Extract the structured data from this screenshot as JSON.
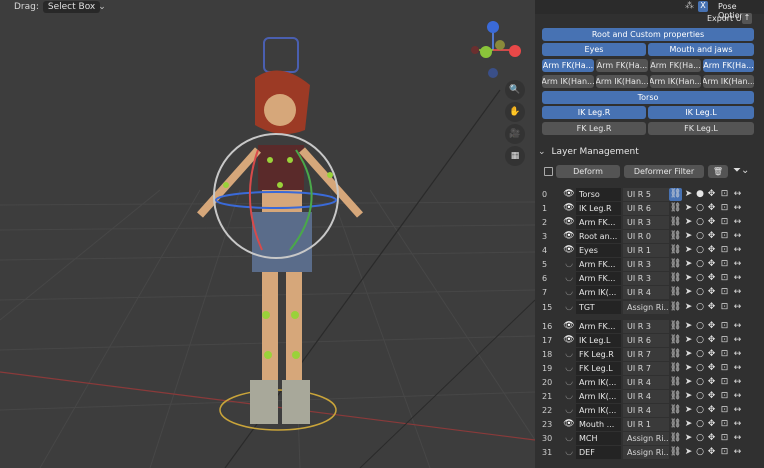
{
  "header": {
    "drag_label": "Drag:",
    "drag_value": "Select Box",
    "pose_options": "Pose Options",
    "export_ui": "Export UI"
  },
  "buttons": {
    "root": "Root and Custom properties",
    "eyes": "Eyes",
    "mouth": "Mouth and jaws",
    "arm_fk_1": "Arm FK(Ha...",
    "arm_fk_2": "Arm FK(Ha...",
    "arm_fk_3": "Arm FK(Ha...",
    "arm_fk_4": "Arm FK(Ha...",
    "arm_ik_1": "Arm IK(Han...",
    "arm_ik_2": "Arm IK(Han...",
    "arm_ik_3": "Arm IK(Han...",
    "arm_ik_4": "Arm IK(Han...",
    "torso": "Torso",
    "ik_leg_r": "IK Leg.R",
    "ik_leg_l": "IK Leg.L",
    "fk_leg_r": "FK Leg.R",
    "fk_leg_l": "FK Leg.L"
  },
  "layer_management": {
    "title": "Layer Management",
    "deform": "Deform",
    "deformer_filter": "Deformer Filter"
  },
  "layers": [
    {
      "num": "0",
      "name": "Torso",
      "ui": "UI R  5",
      "visible": true
    },
    {
      "num": "1",
      "name": "IK Leg.R",
      "ui": "UI R  6",
      "visible": true
    },
    {
      "num": "2",
      "name": "Arm FK...",
      "ui": "UI R  3",
      "visible": true
    },
    {
      "num": "3",
      "name": "Root an...",
      "ui": "UI R  0",
      "visible": true
    },
    {
      "num": "4",
      "name": "Eyes",
      "ui": "UI R  1",
      "visible": true
    },
    {
      "num": "5",
      "name": "Arm FK...",
      "ui": "UI R  3",
      "visible": false
    },
    {
      "num": "6",
      "name": "Arm FK...",
      "ui": "UI R  3",
      "visible": false
    },
    {
      "num": "7",
      "name": "Arm IK(...",
      "ui": "UI R  4",
      "visible": false
    },
    {
      "num": "15",
      "name": "TGT",
      "ui": "Assign Ri...",
      "visible": false
    },
    {
      "num": "16",
      "name": "Arm FK...",
      "ui": "UI R  3",
      "visible": true
    },
    {
      "num": "17",
      "name": "IK Leg.L",
      "ui": "UI R  6",
      "visible": true
    },
    {
      "num": "18",
      "name": "FK Leg.R",
      "ui": "UI R  7",
      "visible": false
    },
    {
      "num": "19",
      "name": "FK Leg.L",
      "ui": "UI R  7",
      "visible": false
    },
    {
      "num": "20",
      "name": "Arm IK(...",
      "ui": "UI R  4",
      "visible": false
    },
    {
      "num": "21",
      "name": "Arm IK(...",
      "ui": "UI R  4",
      "visible": false
    },
    {
      "num": "22",
      "name": "Arm IK(...",
      "ui": "UI R  4",
      "visible": false
    },
    {
      "num": "23",
      "name": "Mouth ...",
      "ui": "UI R  1",
      "visible": true
    },
    {
      "num": "30",
      "name": "MCH",
      "ui": "Assign Ri...",
      "visible": false
    },
    {
      "num": "31",
      "name": "DEF",
      "ui": "Assign Ri...",
      "visible": false
    }
  ],
  "gizmo": {
    "z": "Z",
    "x": "X"
  },
  "colors": {
    "accent": "#4772b3",
    "panel": "#303030",
    "viewport": "#3d3d3d"
  }
}
